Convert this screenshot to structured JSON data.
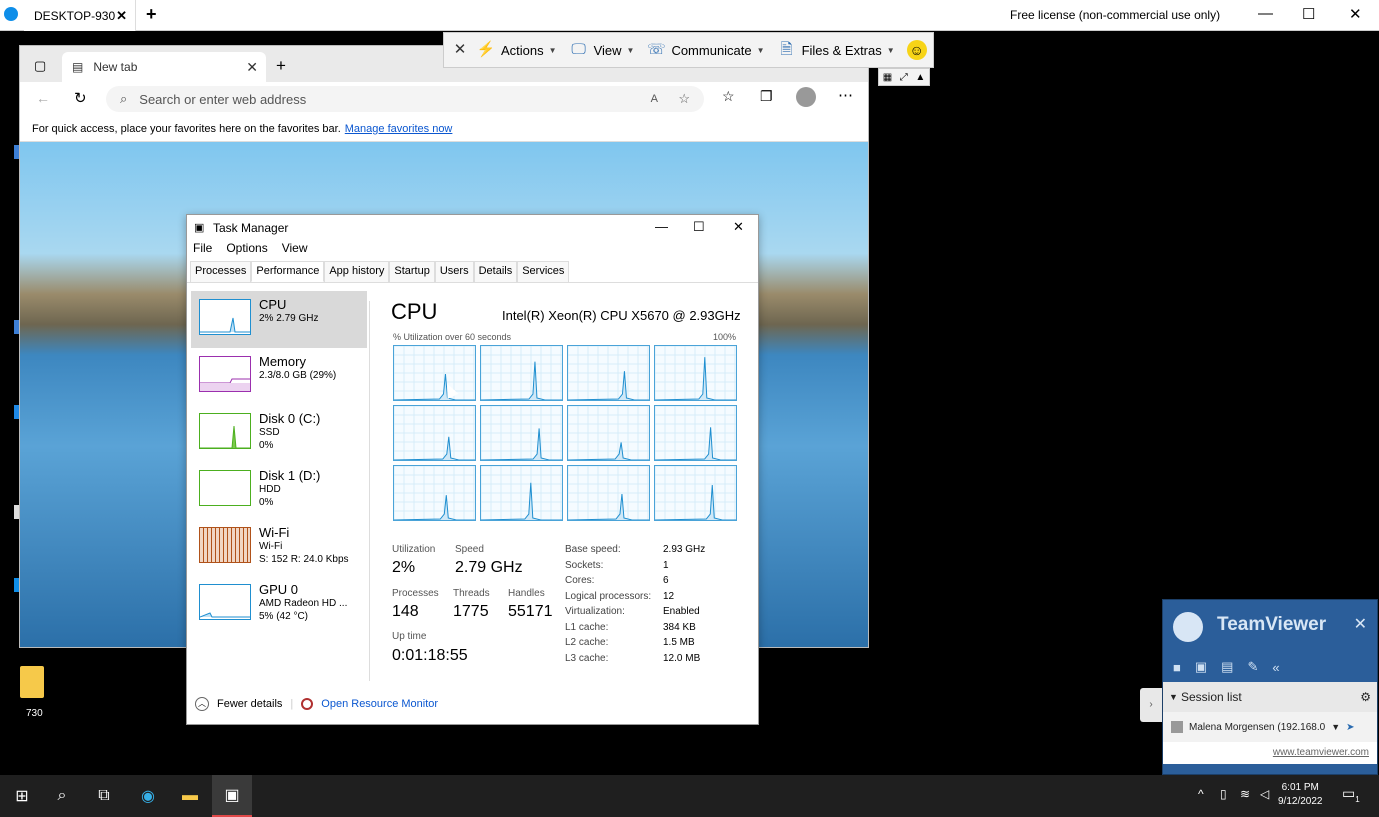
{
  "tv_bar": {
    "tab_title": "DESKTOP-930",
    "tab_close": "✕",
    "new_tab": "+",
    "license": "Free license (non-commercial use only)"
  },
  "remote_toolbar": {
    "items": [
      {
        "label": "Actions",
        "icon": "lightning-icon"
      },
      {
        "label": "View",
        "icon": "monitor-icon"
      },
      {
        "label": "Communicate",
        "icon": "phone-icon"
      },
      {
        "label": "Files & Extras",
        "icon": "file-icon"
      }
    ],
    "smiley": "☺"
  },
  "browser": {
    "tab_title": "New tab",
    "address_placeholder": "Search or enter web address",
    "fav_text": "For quick access, place your favorites here on the favorites bar.",
    "fav_link": "Manage favorites now"
  },
  "desktop": {
    "folder_label": "730"
  },
  "task_manager": {
    "title": "Task Manager",
    "menu": [
      "File",
      "Options",
      "View"
    ],
    "tabs": [
      "Processes",
      "Performance",
      "App history",
      "Startup",
      "Users",
      "Details",
      "Services"
    ],
    "sidebar": [
      {
        "name": "CPU",
        "l2": "2% 2.79 GHz",
        "l3": "",
        "color": "#1f8fd0"
      },
      {
        "name": "Memory",
        "l2": "2.3/8.0 GB (29%)",
        "l3": "",
        "color": "#9b2fae"
      },
      {
        "name": "Disk 0 (C:)",
        "l2": "SSD",
        "l3": "0%",
        "color": "#4caf1f"
      },
      {
        "name": "Disk 1 (D:)",
        "l2": "HDD",
        "l3": "0%",
        "color": "#4caf1f"
      },
      {
        "name": "Wi-Fi",
        "l2": "Wi-Fi",
        "l3": "S: 152  R: 24.0 Kbps",
        "color": "#b0521a"
      },
      {
        "name": "GPU 0",
        "l2": "AMD Radeon HD ...",
        "l3": "5% (42 °C)",
        "color": "#1f8fd0"
      }
    ],
    "heading": "CPU",
    "cpu_name": "Intel(R) Xeon(R) CPU X5670 @ 2.93GHz",
    "util_label": "% Utilization over 60 seconds",
    "util_max": "100%",
    "stats": {
      "utilization_label": "Utilization",
      "utilization": "2%",
      "speed_label": "Speed",
      "speed": "2.79 GHz",
      "processes_label": "Processes",
      "processes": "148",
      "threads_label": "Threads",
      "threads": "1775",
      "handles_label": "Handles",
      "handles": "55171",
      "uptime_label": "Up time",
      "uptime": "0:01:18:55"
    },
    "specs": [
      {
        "k": "Base speed:",
        "v": "2.93 GHz"
      },
      {
        "k": "Sockets:",
        "v": "1"
      },
      {
        "k": "Cores:",
        "v": "6"
      },
      {
        "k": "Logical processors:",
        "v": "12"
      },
      {
        "k": "Virtualization:",
        "v": "Enabled"
      },
      {
        "k": "L1 cache:",
        "v": "384 KB"
      },
      {
        "k": "L2 cache:",
        "v": "1.5 MB"
      },
      {
        "k": "L3 cache:",
        "v": "12.0 MB"
      }
    ],
    "footer": {
      "fewer": "Fewer details",
      "monitor": "Open Resource Monitor"
    }
  },
  "tv_panel": {
    "title": "TeamViewer",
    "session_list": "Session list",
    "session_row": "Malena Morgensen (192.168.0",
    "site": "www.teamviewer.com"
  },
  "taskbar": {
    "time": "6:01 PM",
    "date": "9/12/2022",
    "notif": "1"
  }
}
